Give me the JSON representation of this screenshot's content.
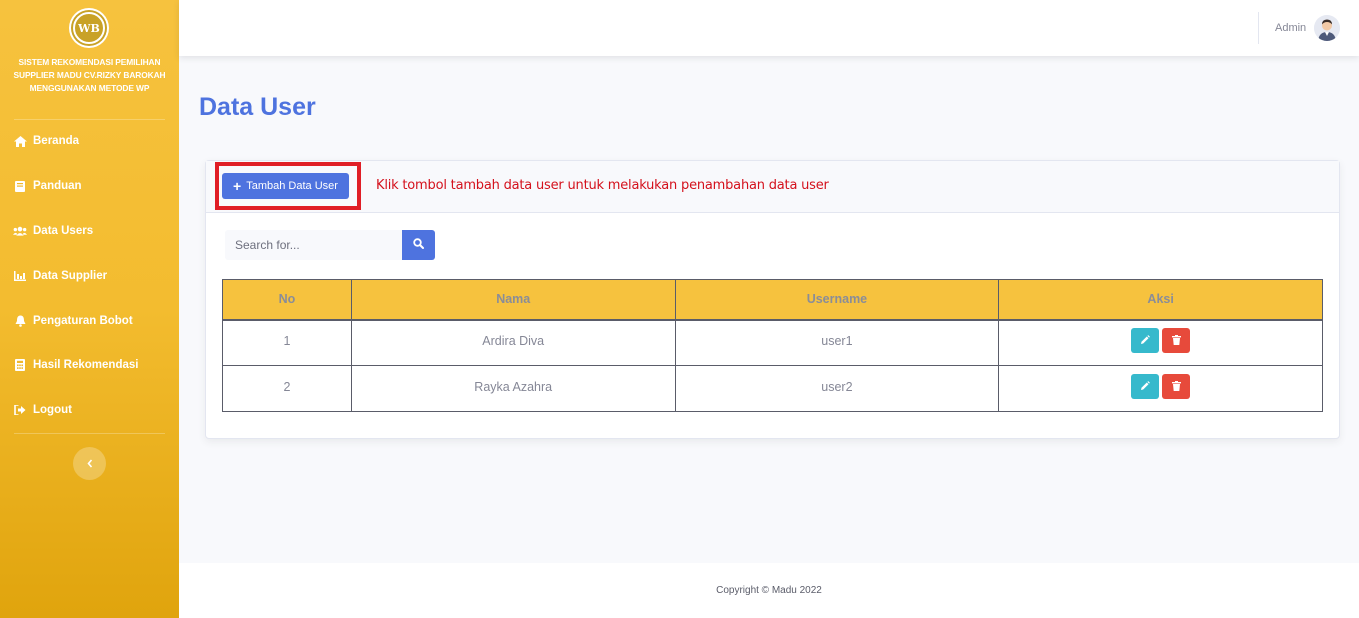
{
  "sidebar": {
    "logo_text": "WB",
    "brand_lines": [
      "SISTEM REKOMENDASI PEMILIHAN",
      "SUPPLIER MADU CV.RIZKY BAROKAH",
      "MENGGUNAKAN METODE WP"
    ],
    "items": [
      {
        "label": "Beranda",
        "icon": "home-icon"
      },
      {
        "label": "Panduan",
        "icon": "book-icon"
      },
      {
        "label": "Data Users",
        "icon": "users-icon"
      },
      {
        "label": "Data Supplier",
        "icon": "chart-icon"
      },
      {
        "label": "Pengaturan Bobot",
        "icon": "bell-icon"
      },
      {
        "label": "Hasil Rekomendasi",
        "icon": "calculator-icon"
      },
      {
        "label": "Logout",
        "icon": "logout-icon"
      }
    ]
  },
  "topbar": {
    "user_name": "Admin"
  },
  "main": {
    "page_title": "Data User",
    "add_button_label": "Tambah Data User",
    "hint_text": "Klik tombol tambah data user untuk melakukan penambahan data user",
    "search": {
      "placeholder": "Search for..."
    },
    "table": {
      "headers": [
        "No",
        "Nama",
        "Username",
        "Aksi"
      ],
      "rows": [
        {
          "no": "1",
          "nama": "Ardira Diva",
          "username": "user1"
        },
        {
          "no": "2",
          "nama": "Rayka Azahra",
          "username": "user2"
        }
      ]
    }
  },
  "footer": {
    "copyright": "Copyright © Madu 2022"
  },
  "colors": {
    "primary": "#4e73df",
    "warning": "#f6c23e",
    "info": "#36b9cc",
    "danger": "#e74a3b",
    "highlight": "#e01e26"
  }
}
